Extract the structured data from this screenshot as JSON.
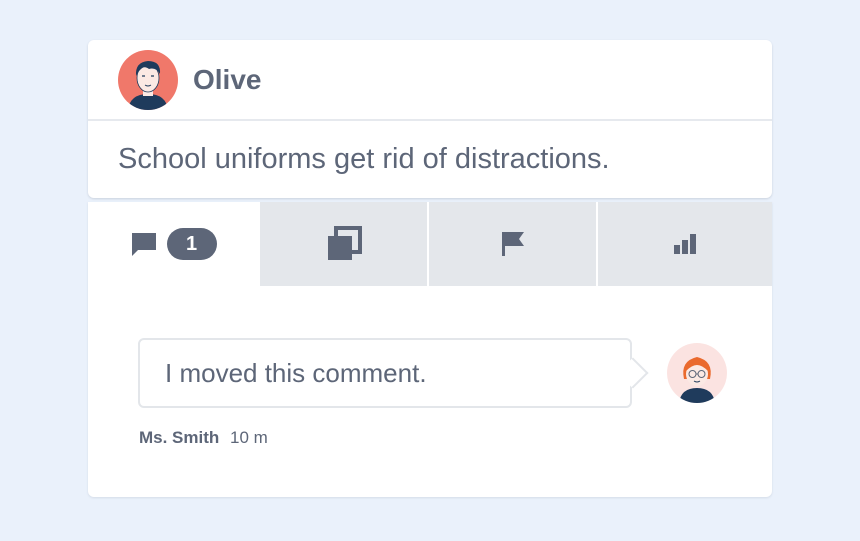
{
  "post": {
    "author": "Olive",
    "text": "School uniforms get rid of distractions."
  },
  "tabs": [
    {
      "icon": "comment-icon",
      "badge": "1",
      "active": true
    },
    {
      "icon": "copy-icon",
      "active": false
    },
    {
      "icon": "flag-icon",
      "active": false
    },
    {
      "icon": "bar-chart-icon",
      "active": false
    }
  ],
  "comment": {
    "text": "I moved this comment.",
    "author": "Ms. Smith",
    "time": "10 m"
  },
  "colors": {
    "background": "#eaf1fb",
    "text": "#5d6678",
    "tab_inactive": "#e4e7eb",
    "author_avatar_bg": "#f0786a",
    "commenter_avatar_bg": "#fbe3e1"
  }
}
